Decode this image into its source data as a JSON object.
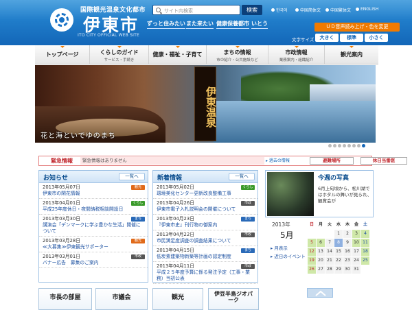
{
  "header": {
    "subtitle": "国際観光温泉文化都市",
    "city_name": "伊東市",
    "english_name": "ITO CITY OFFICIAL WEB SITE",
    "search_placeholder": "サイト内検索",
    "search_button": "検索",
    "languages": [
      "한국어",
      "中国简体文",
      "中国繁体文",
      "ENGLISH"
    ],
    "taglines": [
      "ずっと住みたい",
      "また来たい",
      "健康保養都市",
      "いとう"
    ],
    "ud_button": "ＵＤ音声読み上げ・色を変更",
    "font_size_label": "文字サイズ",
    "font_sizes": [
      "大きく",
      "標準",
      "小さく"
    ]
  },
  "nav": [
    {
      "label": "トップページ",
      "sub": ""
    },
    {
      "label": "くらしのガイド",
      "sub": "サービス・手続き"
    },
    {
      "label": "健康・福祉・子育て",
      "sub": ""
    },
    {
      "label": "まちの情報",
      "sub": "市の紹介・公共施設など"
    },
    {
      "label": "市政情報",
      "sub": "業務案内・組織紹介"
    },
    {
      "label": "観光案内",
      "sub": ""
    }
  ],
  "hero": {
    "banner_text": "伊東温泉",
    "slogan": "花と海といでゆのまち",
    "slide_count": 8,
    "active_slide": 8
  },
  "emergency": {
    "label": "緊急情報",
    "message": "緊急情報はありません",
    "past_link": "過去の情報",
    "evacuation": "避難場所",
    "holiday_doctor": "休日当番医"
  },
  "notices": {
    "title": "お知らせ",
    "more": "一覧へ",
    "items": [
      {
        "date": "2013年05月07日",
        "text": "伊東市の閑花情報",
        "cat": "観光"
      },
      {
        "date": "2013年04月01日",
        "text": "平成25年度休日・夜間納税相談開設日",
        "cat": "くらし"
      },
      {
        "date": "2013年03月30日",
        "text": "講演会「デンマークに学ぶ豊かな生活」開催について",
        "cat": "まち"
      },
      {
        "date": "2013年03月28日",
        "text": "≪大募集≫伊東観光サポーター",
        "cat": "観光"
      },
      {
        "date": "2013年03月01日",
        "text": "バナー広告　募集のご案内",
        "cat": "市政"
      }
    ]
  },
  "news": {
    "title": "新着情報",
    "more": "一覧へ",
    "items": [
      {
        "date": "2013年05月02日",
        "text": "環境美化センター更新改良整備工事",
        "cat": "くらし"
      },
      {
        "date": "2013年04月26日",
        "text": "伊東市電子入札説明会の開催について",
        "cat": "市政"
      },
      {
        "date": "2013年04月23日",
        "text": "『伊東市史』刊行物の御案内",
        "cat": "まち"
      },
      {
        "date": "2013年04月22日",
        "text": "市民満足度調査の調査結果について",
        "cat": "市政"
      },
      {
        "date": "2013年04月15日",
        "text": "低炭素建築物新築等計画の認定制度",
        "cat": "まち"
      },
      {
        "date": "2013年04月11日",
        "text": "平成２５年度予算に係る発注予定（工事・業務）当初公表",
        "cat": "市政"
      }
    ]
  },
  "photo": {
    "title": "今週の写真",
    "text": "6月上旬頃から、松川湖ではホタルの舞いが見られ、　観賞会が"
  },
  "calendar": {
    "year": "2013年",
    "month": "5月",
    "links": [
      "月表示",
      "近日のイベント"
    ],
    "headers": [
      "日",
      "月",
      "火",
      "水",
      "木",
      "金",
      "土"
    ],
    "cells": [
      "",
      "",
      "",
      "1",
      "2",
      "3",
      "4",
      "5",
      "6",
      "7",
      "8",
      "9",
      "10",
      "11",
      "12",
      "13",
      "14",
      "15",
      "16",
      "17",
      "18",
      "19",
      "20",
      "21",
      "22",
      "23",
      "24",
      "25",
      "26",
      "27",
      "28",
      "29",
      "30",
      "31",
      ""
    ]
  },
  "bottom_tiles": [
    "市長の部屋",
    "市議会",
    "観光",
    "伊豆半島ジオパーク"
  ],
  "colors": {
    "header_blue": "#1a73c6",
    "accent_orange": "#f07a00",
    "emergency_red": "#c0272d",
    "cat_kanko": "#e06a1a",
    "cat_kurashi": "#3a9a2a",
    "cat_machi": "#2a6ab8",
    "cat_shisei": "#555555"
  }
}
